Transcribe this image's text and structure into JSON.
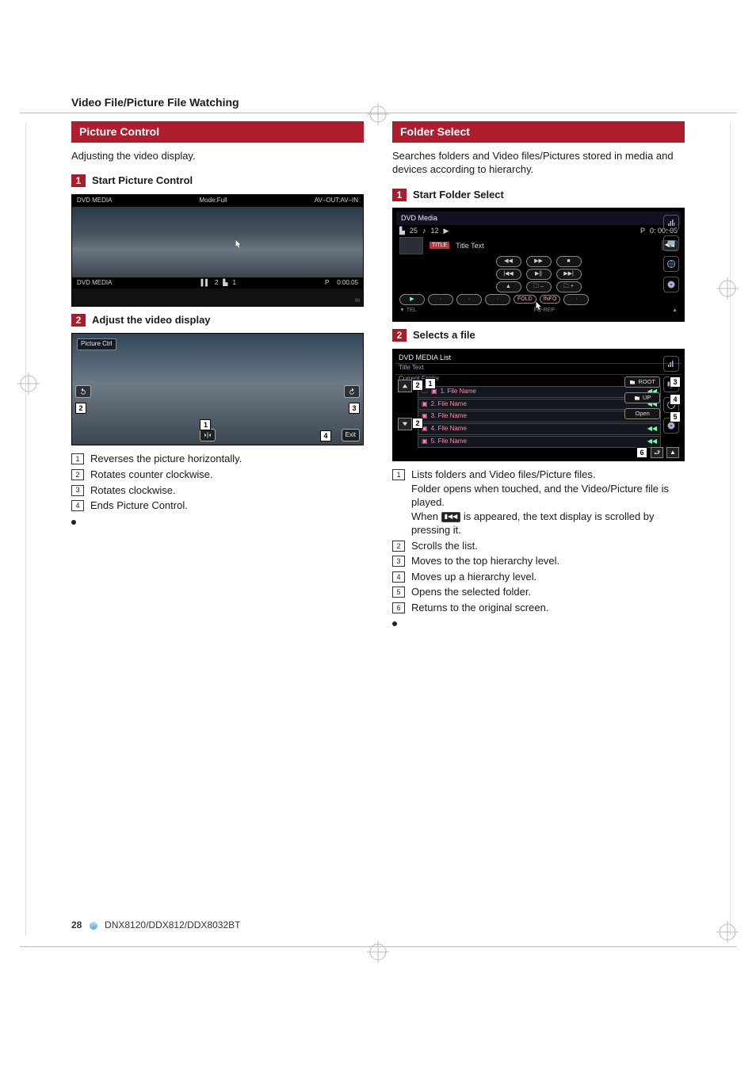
{
  "header": {
    "section_title": "Video File/Picture File Watching"
  },
  "left": {
    "panel_title": "Picture Control",
    "lead": "Adjusting the video display.",
    "step1": {
      "num": "1",
      "text": "Start Picture Control"
    },
    "shot1": {
      "top": {
        "source": "DVD MEDIA",
        "mode": "Mode:Full",
        "avout": "AV–OUT:AV–IN"
      },
      "status": {
        "source": "DVD MEDIA",
        "disc_ico": "▌▌",
        "disc_num": "2",
        "track_ico": "▙",
        "track_num": "1",
        "state": "P",
        "time": "0:00:05",
        "in_lbl": "IN"
      }
    },
    "step2": {
      "num": "2",
      "text": "Adjust the video display"
    },
    "shot2": {
      "label": "Picture Ctrl",
      "exit": "Exit"
    },
    "callouts": [
      "1",
      "2",
      "3",
      "4"
    ],
    "enum": [
      {
        "n": "1",
        "t": "Reverses the picture horizontally."
      },
      {
        "n": "2",
        "t": "Rotates counter clockwise."
      },
      {
        "n": "3",
        "t": "Rotates clockwise."
      },
      {
        "n": "4",
        "t": "Ends Picture Control."
      }
    ]
  },
  "right": {
    "panel_title": "Folder Select",
    "lead": "Searches folders and Video files/Pictures stored in media and devices according to hierarchy.",
    "step1": {
      "num": "1",
      "text": "Start Folder Select"
    },
    "device": {
      "title": "DVD Media",
      "row1": {
        "chap_ico": "▙",
        "chap": "25",
        "track_ico": "♪",
        "track": "12",
        "play": "▶",
        "state": "P",
        "time": "0: 00: 05"
      },
      "row2": {
        "title_lbl": "TITLE",
        "title_text": "Title Text"
      },
      "buttons": {
        "info": "INFO",
        "fold": "FOLD"
      },
      "footer": {
        "tel": "TEL",
        "rep": "FO-REP"
      }
    },
    "step2": {
      "num": "2",
      "text": "Selects a file"
    },
    "list": {
      "header": "DVD MEDIA List",
      "title": "Title Text",
      "current": "Current Folder",
      "root_btn": "ROOT",
      "up_btn": "UP",
      "open_btn": "Open",
      "files": [
        {
          "n": "1",
          "name": "1. File Name"
        },
        {
          "n": "2",
          "name": "2. File Name"
        },
        {
          "n": "3",
          "name": "3. File Name"
        },
        {
          "n": "4",
          "name": "4. File Name"
        },
        {
          "n": "5",
          "name": "5. File Name"
        }
      ],
      "callouts": [
        "1",
        "2",
        "3",
        "4",
        "5",
        "6"
      ]
    },
    "enum": {
      "prefix": "When ",
      "scroll_chip": "▮◀◀",
      "mid": " is appeared, the text display is scrolled by pressing it.",
      "items": [
        {
          "n": "1",
          "t": "Lists folders and Video files/Picture files.",
          "t2": "Folder opens when touched, and the Video/Picture file is played."
        },
        {
          "n": "2",
          "t": "Scrolls the list."
        },
        {
          "n": "3",
          "t": "Moves to the top hierarchy level."
        },
        {
          "n": "4",
          "t": "Moves up a hierarchy level."
        },
        {
          "n": "5",
          "t": "Opens the selected folder."
        },
        {
          "n": "6",
          "t": "Returns to the original screen."
        }
      ]
    }
  },
  "footer": {
    "page": "28",
    "models": "DNX8120/DDX812/DDX8032BT"
  }
}
